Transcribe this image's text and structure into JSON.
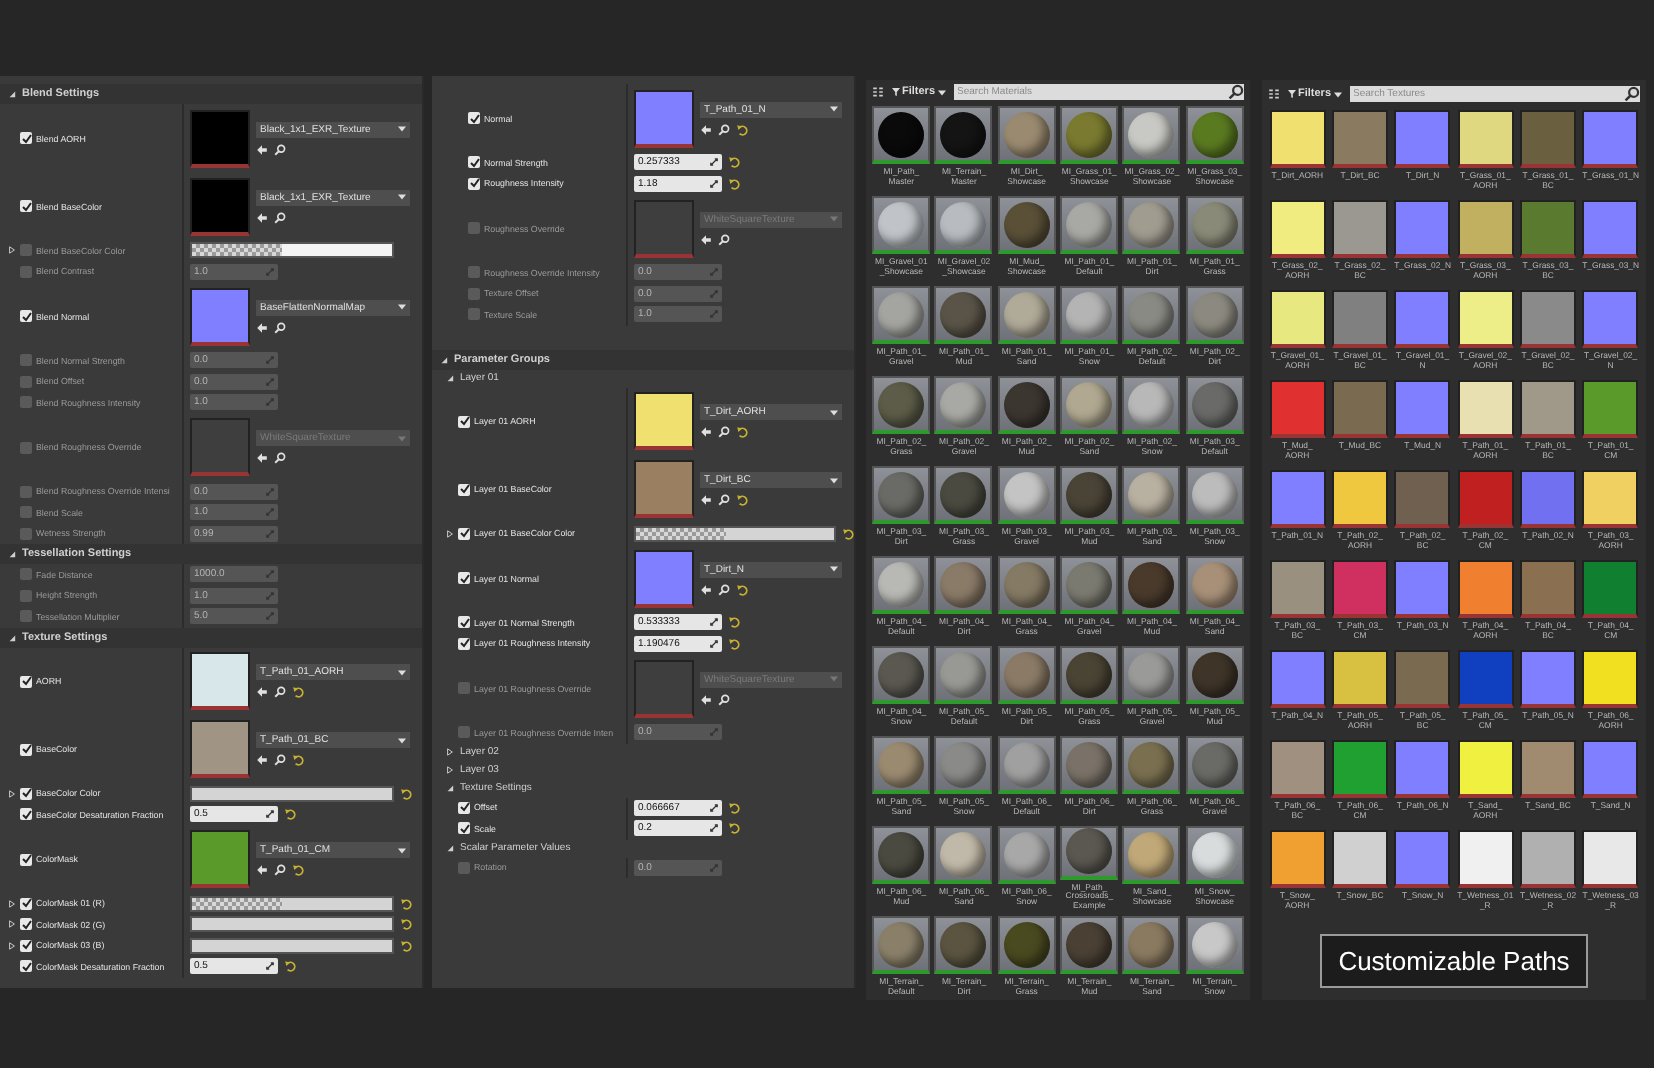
{
  "left_panel": {
    "sections": [
      {
        "title": "Blend Settings",
        "expanded": true,
        "children": [
          {
            "kind": "texture",
            "label": "Blend AORH",
            "checked": true,
            "color": "#000000",
            "value": "Black_1x1_EXR_Texture",
            "reset": false
          },
          {
            "kind": "texture",
            "label": "Blend BaseColor",
            "checked": true,
            "color": "#000000",
            "value": "Black_1x1_EXR_Texture",
            "reset": false
          },
          {
            "kind": "color",
            "label": "Blend BaseColor Color",
            "checked": false,
            "transparent": true,
            "reset": false
          },
          {
            "kind": "number",
            "label": "Blend Contrast",
            "checked": false,
            "value": "1.0",
            "reset": false
          },
          {
            "kind": "texture",
            "label": "Blend Normal",
            "checked": true,
            "color": "#7f7fff",
            "value": "BaseFlattenNormalMap",
            "reset": false
          },
          {
            "kind": "number",
            "label": "Blend Normal Strength",
            "checked": false,
            "value": "0.0",
            "reset": false
          },
          {
            "kind": "number",
            "label": "Blend Offset",
            "checked": false,
            "value": "0.0",
            "reset": false
          },
          {
            "kind": "number",
            "label": "Blend Roughness Intensity",
            "checked": false,
            "value": "1.0",
            "reset": false
          },
          {
            "kind": "texture",
            "label": "Blend Roughness Override",
            "checked": false,
            "color": "#3e3e3e",
            "value": "WhiteSquareTexture",
            "reset": false
          },
          {
            "kind": "number",
            "label": "Blend Roughness Override Intensi",
            "checked": false,
            "value": "0.0",
            "reset": false
          },
          {
            "kind": "number",
            "label": "Blend Scale",
            "checked": false,
            "value": "1.0",
            "reset": false
          },
          {
            "kind": "number",
            "label": "Wetness Strength",
            "checked": false,
            "value": "0.99",
            "reset": false
          }
        ]
      },
      {
        "title": "Tessellation Settings",
        "expanded": true,
        "children": [
          {
            "kind": "number",
            "label": "Fade Distance",
            "checked": false,
            "value": "1000.0",
            "reset": false
          },
          {
            "kind": "number",
            "label": "Height Strength",
            "checked": false,
            "value": "1.0",
            "reset": false
          },
          {
            "kind": "number",
            "label": "Tessellation Multiplier",
            "checked": false,
            "value": "5.0",
            "reset": false
          }
        ]
      },
      {
        "title": "Texture Settings",
        "expanded": true,
        "children": [
          {
            "kind": "texture",
            "label": "AORH",
            "checked": true,
            "color": "#d8e8ea",
            "value": "T_Path_01_AORH",
            "reset": true
          },
          {
            "kind": "texture",
            "label": "BaseColor",
            "checked": true,
            "color": "#a09484",
            "value": "T_Path_01_BC",
            "reset": true
          },
          {
            "kind": "color",
            "label": "BaseColor Color",
            "checked": true,
            "transparent": false,
            "reset": true
          },
          {
            "kind": "number",
            "label": "BaseColor Desaturation Fraction",
            "checked": true,
            "value": "0.5",
            "reset": true
          },
          {
            "kind": "texture",
            "label": "ColorMask",
            "checked": true,
            "color": "#5a9a2a",
            "value": "T_Path_01_CM",
            "reset": true
          },
          {
            "kind": "color",
            "label": "ColorMask 01 (R)",
            "checked": true,
            "transparent": true,
            "reset": true
          },
          {
            "kind": "color",
            "label": "ColorMask 02 (G)",
            "checked": true,
            "transparent": false,
            "reset": true
          },
          {
            "kind": "color",
            "label": "ColorMask 03 (B)",
            "checked": true,
            "transparent": false,
            "reset": true
          },
          {
            "kind": "number",
            "label": "ColorMask Desaturation Fraction",
            "checked": true,
            "value": "0.5",
            "reset": true
          }
        ]
      }
    ]
  },
  "middle_panel": {
    "rows": [
      {
        "kind": "texture",
        "label": "Normal",
        "checked": true,
        "color": "#7f7fff",
        "value": "T_Path_01_N",
        "reset": true
      },
      {
        "kind": "number",
        "label": "Normal Strength",
        "checked": true,
        "value": "0.257333",
        "reset": true
      },
      {
        "kind": "number",
        "label": "Roughness Intensity",
        "checked": true,
        "value": "1.18",
        "reset": true
      },
      {
        "kind": "texture",
        "label": "Roughness Override",
        "checked": false,
        "color": "#3e3e3e",
        "value": "WhiteSquareTexture",
        "reset": false
      },
      {
        "kind": "number",
        "label": "Roughness Override Intensity",
        "checked": false,
        "value": "0.0",
        "reset": false
      },
      {
        "kind": "number",
        "label": "Texture Offset",
        "checked": false,
        "value": "0.0",
        "reset": false
      },
      {
        "kind": "number",
        "label": "Texture Scale",
        "checked": false,
        "value": "1.0",
        "reset": false
      }
    ],
    "sections": [
      {
        "title": "Parameter Groups",
        "expanded": true,
        "children": [
          {
            "kind": "section",
            "title": "Layer 01",
            "expanded": true,
            "children": [
              {
                "kind": "texture",
                "label": "Layer 01 AORH",
                "checked": true,
                "color": "#f0e070",
                "value": "T_Dirt_AORH",
                "reset": true
              },
              {
                "kind": "texture",
                "label": "Layer 01 BaseColor",
                "checked": true,
                "color": "#9a8060",
                "value": "T_Dirt_BC",
                "reset": true
              },
              {
                "kind": "color",
                "label": "Layer 01 BaseColor Color",
                "checked": true,
                "transparent": true,
                "reset": true
              },
              {
                "kind": "texture",
                "label": "Layer 01 Normal",
                "checked": true,
                "color": "#7f7fff",
                "value": "T_Dirt_N",
                "reset": true
              },
              {
                "kind": "number",
                "label": "Layer 01 Normal Strength",
                "checked": true,
                "value": "0.533333",
                "reset": true
              },
              {
                "kind": "number",
                "label": "Layer 01 Roughness Intensity",
                "checked": true,
                "value": "1.190476",
                "reset": true
              },
              {
                "kind": "texture",
                "label": "Layer 01 Roughness Override",
                "checked": false,
                "color": "#3e3e3e",
                "value": "WhiteSquareTexture",
                "reset": false
              },
              {
                "kind": "number",
                "label": "Layer 01 Roughness Override Inten",
                "checked": false,
                "value": "0.0",
                "reset": false
              }
            ]
          },
          {
            "kind": "section",
            "title": "Layer 02",
            "expanded": false
          },
          {
            "kind": "section",
            "title": "Layer 03",
            "expanded": false
          },
          {
            "kind": "section",
            "title": "Texture Settings",
            "expanded": true,
            "children": [
              {
                "kind": "number",
                "label": "Offset",
                "checked": true,
                "value": "0.066667",
                "reset": true
              },
              {
                "kind": "number",
                "label": "Scale",
                "checked": true,
                "value": "0.2",
                "reset": true
              }
            ]
          },
          {
            "kind": "section",
            "title": "Scalar Parameter Values",
            "expanded": true,
            "children": [
              {
                "kind": "number",
                "label": "Rotation",
                "checked": false,
                "value": "0.0",
                "reset": false
              }
            ]
          }
        ]
      }
    ]
  },
  "materials": {
    "filter": "Filters",
    "search": {
      "placeholder": "Search Materials"
    },
    "items": [
      {
        "label": "MI_Path_\nMaster",
        "color": "#0a0a0a"
      },
      {
        "label": "MI_Terrain_\nMaster",
        "color": "#141414"
      },
      {
        "label": "MI_Dirt_\nShowcase",
        "color": "#9a8a70"
      },
      {
        "label": "MI_Grass_01_\nShowcase",
        "color": "#7a7a30"
      },
      {
        "label": "MI_Grass_02_\nShowcase",
        "color": "#c8c8c4"
      },
      {
        "label": "MI_Grass_03_\nShowcase",
        "color": "#5a7a20"
      },
      {
        "label": "MI_Gravel_01\n_Showcase",
        "color": "#c0c4c8"
      },
      {
        "label": "MI_Gravel_02\n_Showcase",
        "color": "#b8bcc0"
      },
      {
        "label": "MI_Mud_\nShowcase",
        "color": "#5a5038"
      },
      {
        "label": "MI_Path_01_\nDefault",
        "color": "#a8a8a4"
      },
      {
        "label": "MI_Path_01_\nDirt",
        "color": "#a09c90"
      },
      {
        "label": "MI_Path_01_\nGrass",
        "color": "#8a8a78"
      },
      {
        "label": "MI_Path_01_\nGravel",
        "color": "#a4a4a0"
      },
      {
        "label": "MI_Path_01_\nMud",
        "color": "#5a5448"
      },
      {
        "label": "MI_Path_01_\nSand",
        "color": "#b0aa98"
      },
      {
        "label": "MI_Path_01_\nSnow",
        "color": "#b4b4b4"
      },
      {
        "label": "MI_Path_02_\nDefault",
        "color": "#8a8a84"
      },
      {
        "label": "MI_Path_02_\nDirt",
        "color": "#8c8a80"
      },
      {
        "label": "MI_Path_02_\nGrass",
        "color": "#5c5c48"
      },
      {
        "label": "MI_Path_02_\nGravel",
        "color": "#a8a8a4"
      },
      {
        "label": "MI_Path_02_\nMud",
        "color": "#3c3630"
      },
      {
        "label": "MI_Path_02_\nSand",
        "color": "#b0a890"
      },
      {
        "label": "MI_Path_02_\nSnow",
        "color": "#b8b8b8"
      },
      {
        "label": "MI_Path_03_\nDefault",
        "color": "#6a6a68"
      },
      {
        "label": "MI_Path_03_\nDirt",
        "color": "#6a6a66"
      },
      {
        "label": "MI_Path_03_\nGrass",
        "color": "#4a4a40"
      },
      {
        "label": "MI_Path_03_\nGravel",
        "color": "#c4c4c4"
      },
      {
        "label": "MI_Path_03_\nMud",
        "color": "#4a4436"
      },
      {
        "label": "MI_Path_03_\nSand",
        "color": "#b8b0a0"
      },
      {
        "label": "MI_Path_03_\nSnow",
        "color": "#bcbcbc"
      },
      {
        "label": "MI_Path_04_\nDefault",
        "color": "#b8b8b4"
      },
      {
        "label": "MI_Path_04_\nDirt",
        "color": "#8a7a68"
      },
      {
        "label": "MI_Path_04_\nGrass",
        "color": "#857a64"
      },
      {
        "label": "MI_Path_04_\nGravel",
        "color": "#7a7a70"
      },
      {
        "label": "MI_Path_04_\nMud",
        "color": "#4a3a2c"
      },
      {
        "label": "MI_Path_04_\nSand",
        "color": "#a89078"
      },
      {
        "label": "MI_Path_04_\nSnow",
        "color": "#5a5850"
      },
      {
        "label": "MI_Path_05_\nDefault",
        "color": "#989894"
      },
      {
        "label": "MI_Path_05_\nDirt",
        "color": "#8a7a66"
      },
      {
        "label": "MI_Path_05_\nGrass",
        "color": "#4a4434"
      },
      {
        "label": "MI_Path_05_\nGravel",
        "color": "#9a9a98"
      },
      {
        "label": "MI_Path_05_\nMud",
        "color": "#3e3428"
      },
      {
        "label": "MI_Path_05_\nSand",
        "color": "#9a8a70"
      },
      {
        "label": "MI_Path_05_\nSnow",
        "color": "#8a8a88"
      },
      {
        "label": "MI_Path_06_\nDefault",
        "color": "#a0a0a0"
      },
      {
        "label": "MI_Path_06_\nDirt",
        "color": "#7a7268"
      },
      {
        "label": "MI_Path_06_\nGrass",
        "color": "#7a7050"
      },
      {
        "label": "MI_Path_06_\nGravel",
        "color": "#6a6a66"
      },
      {
        "label": "MI_Path_06_\nMud",
        "color": "#4a4a40"
      },
      {
        "label": "MI_Path_06_\nSand",
        "color": "#c0b8a8"
      },
      {
        "label": "MI_Path_06_\nSnow",
        "color": "#a8a8a8"
      },
      {
        "label": "MI_Path_\nCrossroads_\nExample",
        "color": "#5a5850"
      },
      {
        "label": "MI_Sand_\nShowcase",
        "color": "#c0a878"
      },
      {
        "label": "MI_Snow_\nShowcase",
        "color": "#d8dcdc"
      },
      {
        "label": "MI_Terrain_\nDefault",
        "color": "#8a806a"
      },
      {
        "label": "MI_Terrain_\nDirt",
        "color": "#5a5440"
      },
      {
        "label": "MI_Terrain_\nGrass",
        "color": "#4a4a20"
      },
      {
        "label": "MI_Terrain_\nMud",
        "color": "#4a4034"
      },
      {
        "label": "MI_Terrain_\nSand",
        "color": "#8a7a60"
      },
      {
        "label": "MI_Terrain_\nSnow",
        "color": "#c8c8c8"
      }
    ]
  },
  "textures": {
    "filter": "Filters",
    "search": {
      "placeholder": "Search Textures"
    },
    "items": [
      {
        "label": "T_Dirt_AORH",
        "color": "#f0e070"
      },
      {
        "label": "T_Dirt_BC",
        "color": "#8a7a60"
      },
      {
        "label": "T_Dirt_N",
        "color": "#7f7fff"
      },
      {
        "label": "T_Grass_01_\nAORH",
        "color": "#e0d880"
      },
      {
        "label": "T_Grass_01_\nBC",
        "color": "#6a6040"
      },
      {
        "label": "T_Grass_01_N",
        "color": "#7f7fff"
      },
      {
        "label": "T_Grass_02_\nAORH",
        "color": "#f0ec80"
      },
      {
        "label": "T_Grass_02_\nBC",
        "color": "#9a9890"
      },
      {
        "label": "T_Grass_02_N",
        "color": "#7f7fff"
      },
      {
        "label": "T_Grass_03_\nAORH",
        "color": "#c0b060"
      },
      {
        "label": "T_Grass_03_\nBC",
        "color": "#5a7a30"
      },
      {
        "label": "T_Grass_03_N",
        "color": "#7f7fff"
      },
      {
        "label": "T_Gravel_01_\nAORH",
        "color": "#e8e880"
      },
      {
        "label": "T_Gravel_01_\nBC",
        "color": "#808080"
      },
      {
        "label": "T_Gravel_01_\nN",
        "color": "#7f7fff"
      },
      {
        "label": "T_Gravel_02_\nAORH",
        "color": "#eeee88"
      },
      {
        "label": "T_Gravel_02_\nBC",
        "color": "#8a8a8a"
      },
      {
        "label": "T_Gravel_02_\nN",
        "color": "#7f7fff"
      },
      {
        "label": "T_Mud_\nAORH",
        "color": "#e03030"
      },
      {
        "label": "T_Mud_BC",
        "color": "#7a6a50"
      },
      {
        "label": "T_Mud_N",
        "color": "#7f7fff"
      },
      {
        "label": "T_Path_01_\nAORH",
        "color": "#e8e0b0"
      },
      {
        "label": "T_Path_01_\nBC",
        "color": "#a09888"
      },
      {
        "label": "T_Path_01_\nCM",
        "color": "#5a9a2a"
      },
      {
        "label": "T_Path_01_N",
        "color": "#7f7fff"
      },
      {
        "label": "T_Path_02_\nAORH",
        "color": "#f0c840"
      },
      {
        "label": "T_Path_02_\nBC",
        "color": "#706050"
      },
      {
        "label": "T_Path_02_\nCM",
        "color": "#c02020"
      },
      {
        "label": "T_Path_02_N",
        "color": "#7070f0"
      },
      {
        "label": "T_Path_03_\nAORH",
        "color": "#f0d060"
      },
      {
        "label": "T_Path_03_\nBC",
        "color": "#9a9080"
      },
      {
        "label": "T_Path_03_\nCM",
        "color": "#d03060"
      },
      {
        "label": "T_Path_03_N",
        "color": "#7f7fff"
      },
      {
        "label": "T_Path_04_\nAORH",
        "color": "#f08030"
      },
      {
        "label": "T_Path_04_\nBC",
        "color": "#8a7050"
      },
      {
        "label": "T_Path_04_\nCM",
        "color": "#108030"
      },
      {
        "label": "T_Path_04_N",
        "color": "#7f7fff"
      },
      {
        "label": "T_Path_05_\nAORH",
        "color": "#d8c040"
      },
      {
        "label": "T_Path_05_\nBC",
        "color": "#7a6a50"
      },
      {
        "label": "T_Path_05_\nCM",
        "color": "#1040c0"
      },
      {
        "label": "T_Path_05_N",
        "color": "#7f7fff"
      },
      {
        "label": "T_Path_06_\nAORH",
        "color": "#f0e020"
      },
      {
        "label": "T_Path_06_\nBC",
        "color": "#a09080"
      },
      {
        "label": "T_Path_06_\nCM",
        "color": "#20a030"
      },
      {
        "label": "T_Path_06_N",
        "color": "#7f7fff"
      },
      {
        "label": "T_Sand_\nAORH",
        "color": "#f0f040"
      },
      {
        "label": "T_Sand_BC",
        "color": "#a08a70"
      },
      {
        "label": "T_Sand_N",
        "color": "#7f7fff"
      },
      {
        "label": "T_Snow_\nAORH",
        "color": "#f0a030"
      },
      {
        "label": "T_Snow_BC",
        "color": "#d0d0d0"
      },
      {
        "label": "T_Snow_N",
        "color": "#7f7fff"
      },
      {
        "label": "T_Wetness_01\n_R",
        "color": "#f0f0f0"
      },
      {
        "label": "T_Wetness_02\n_R",
        "color": "#b0b0b0"
      },
      {
        "label": "T_Wetness_03\n_R",
        "color": "#e8e8e8"
      }
    ]
  },
  "action_button": "Customizable Paths"
}
